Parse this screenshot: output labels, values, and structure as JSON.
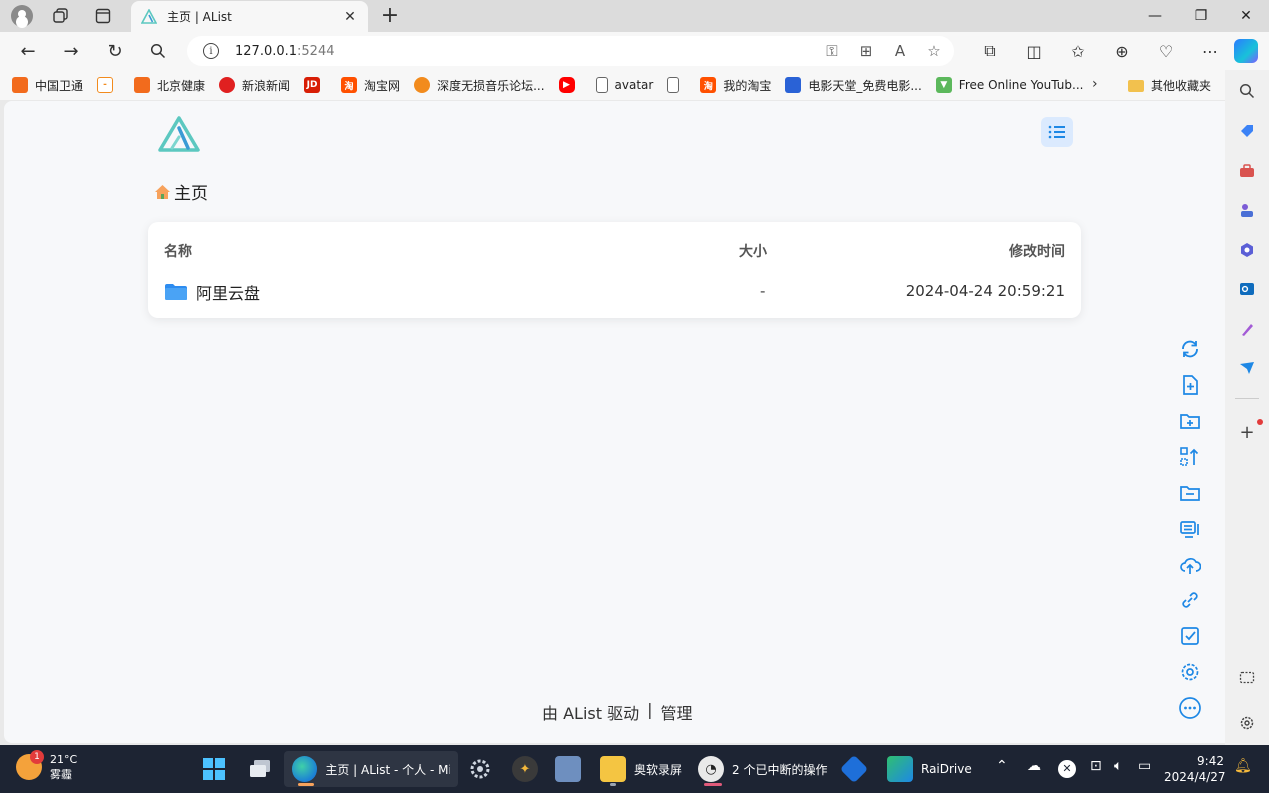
{
  "browser": {
    "tab_title": "主页 | AList",
    "url_host": "127.0.0.1",
    "url_port": ":5244"
  },
  "bookmarks": [
    {
      "label": "中国卫通",
      "color": "#f26b1d"
    },
    {
      "label": "",
      "color": "#f28b1d"
    },
    {
      "label": "北京健康",
      "color": "#f26b1d"
    },
    {
      "label": "新浪新闻",
      "color": "#e02020"
    },
    {
      "label": "",
      "color": "#d81e06"
    },
    {
      "label": "淘宝网",
      "color": "#ff5000"
    },
    {
      "label": "深度无损音乐论坛...",
      "color": "#f28b1d"
    },
    {
      "label": "",
      "color": "#ff0000"
    },
    {
      "label": "avatar",
      "color": "#888888"
    },
    {
      "label": "",
      "color": "#888888"
    },
    {
      "label": "我的淘宝",
      "color": "#ff5000"
    },
    {
      "label": "电影天堂_免费电影...",
      "color": "#2a62d6"
    },
    {
      "label": "Free Online YouTub...",
      "color": "#5cb85c"
    }
  ],
  "bookmarks_folder": "其他收藏夹",
  "page": {
    "breadcrumb_home": "主页",
    "columns": {
      "name": "名称",
      "size": "大小",
      "modified": "修改时间"
    },
    "rows": [
      {
        "name": "阿里云盘",
        "size": "-",
        "modified": "2024-04-24 20:59:21"
      }
    ],
    "footer_powered": "由 AList 驱动",
    "footer_sep": "|",
    "footer_manage": "管理"
  },
  "taskbar": {
    "weather_temp": "21°C",
    "weather_desc": "雾霾",
    "weather_badge": "1",
    "edge_label": "主页 | AList - 个人 - Mic",
    "recorder_label": "奥软录屏",
    "ops_label": "2 个已中断的操作",
    "raidrive_label": "RaiDrive",
    "time": "9:42",
    "date": "2024/4/27"
  },
  "colors": {
    "accent": "#1e88e5",
    "logo": "#5cc8c0",
    "folder": "#2d8cf0"
  }
}
